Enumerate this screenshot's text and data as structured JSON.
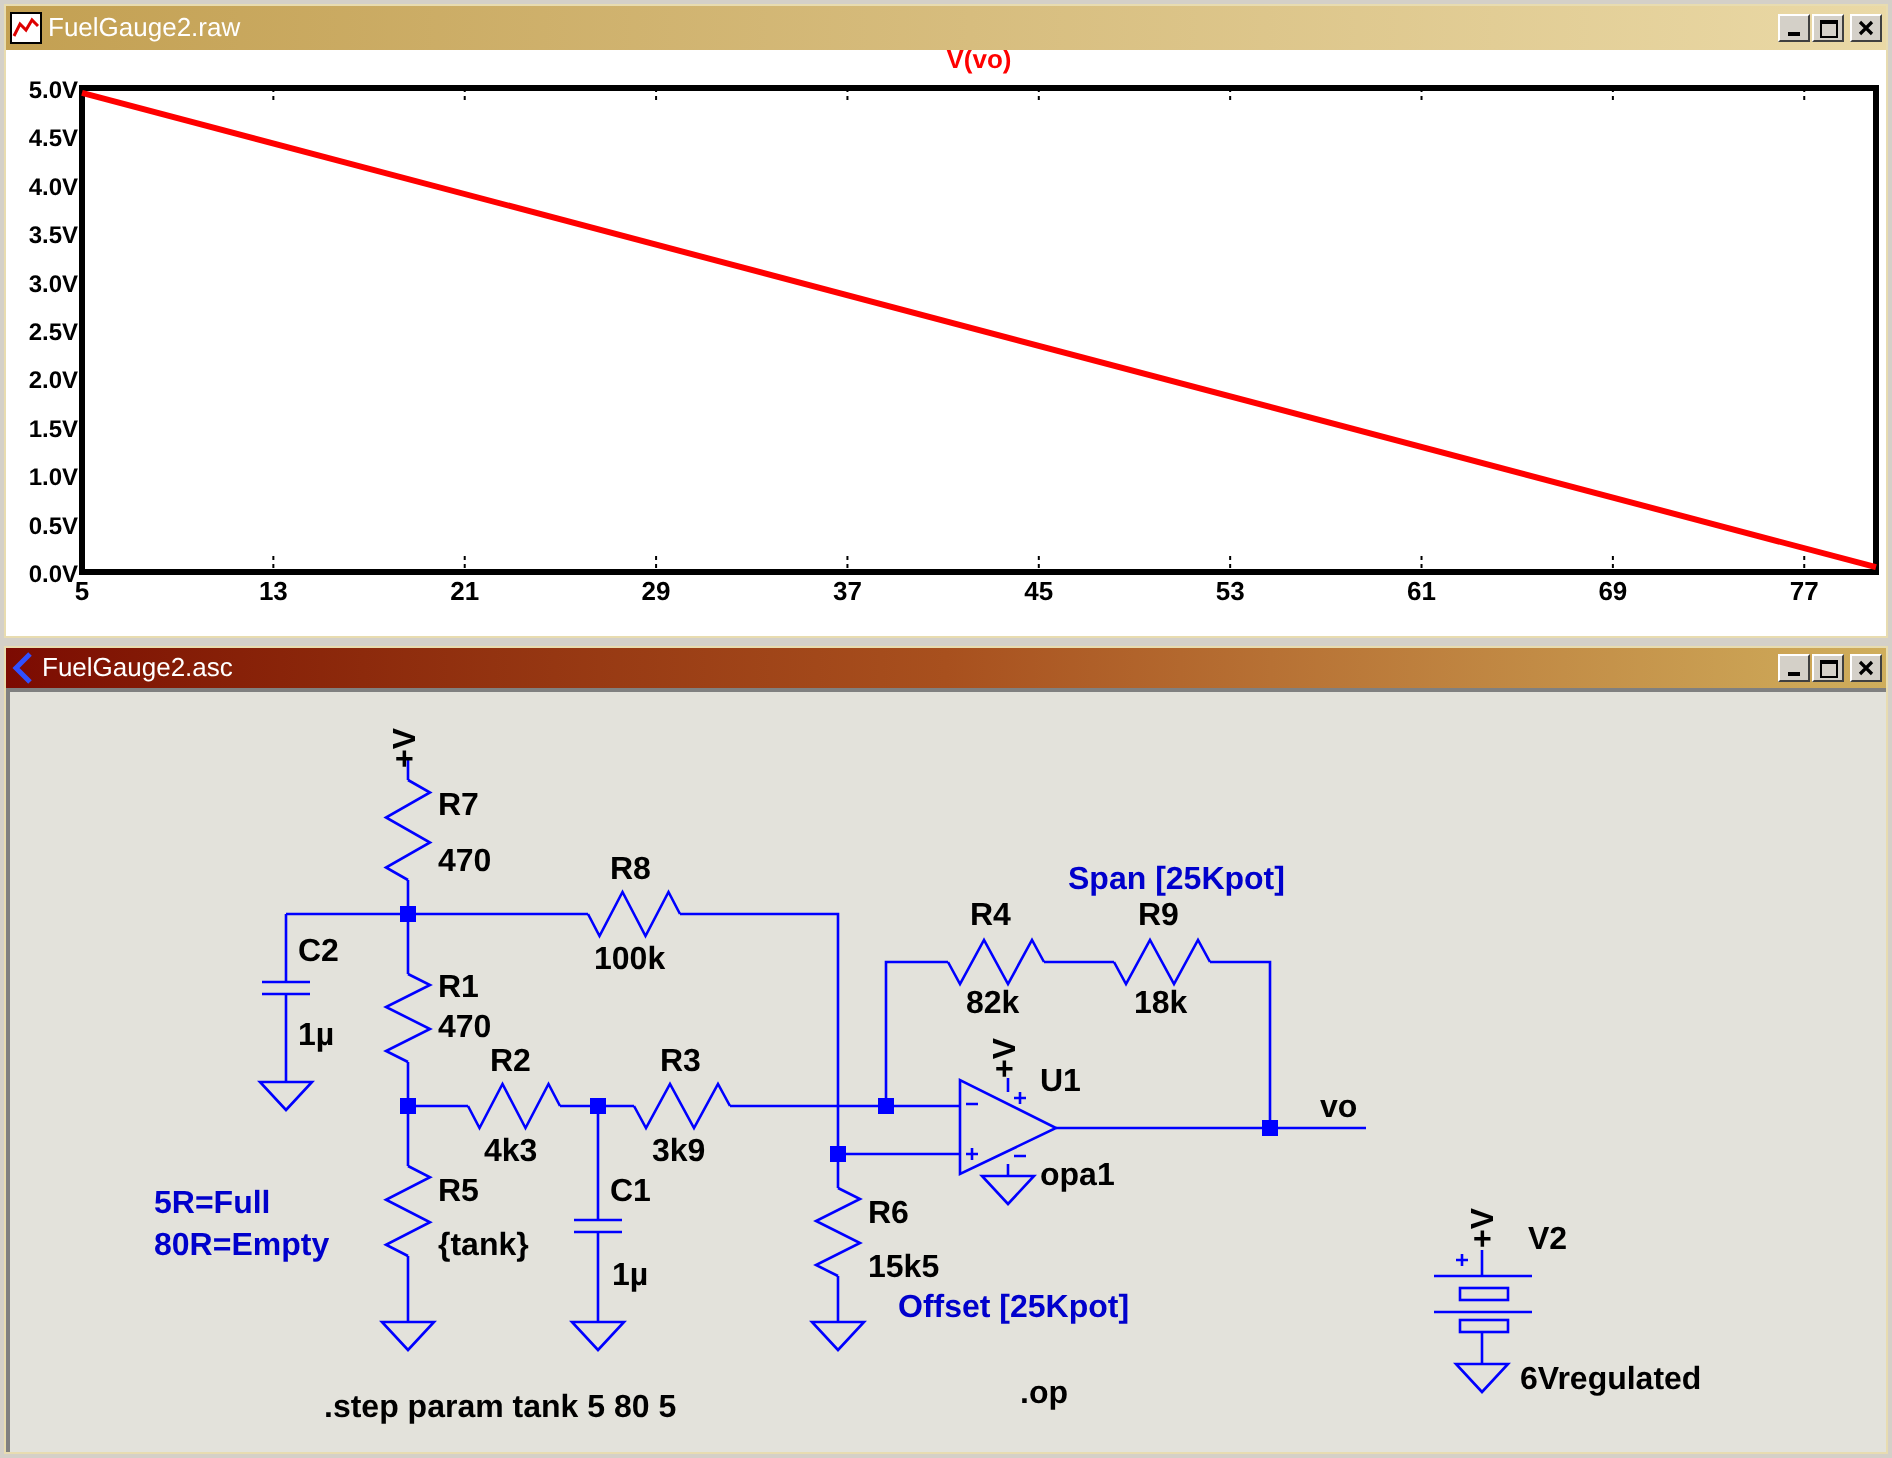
{
  "plot_window": {
    "title": "FuelGauge2.raw",
    "chart_data": {
      "type": "line",
      "x": [
        5,
        80
      ],
      "series": [
        {
          "name": "V(vo)",
          "color": "#ff0000",
          "values": [
            4.95,
            0.05
          ]
        }
      ],
      "xlim": [
        5,
        80
      ],
      "ylim": [
        0,
        5
      ],
      "xticks": [
        5,
        13,
        21,
        29,
        37,
        45,
        53,
        61,
        69,
        77
      ],
      "yticks": [
        {
          "value": 0,
          "label": "0.0V"
        },
        {
          "value": 0.5,
          "label": "0.5V"
        },
        {
          "value": 1,
          "label": "1.0V"
        },
        {
          "value": 1.5,
          "label": "1.5V"
        },
        {
          "value": 2,
          "label": "2.0V"
        },
        {
          "value": 2.5,
          "label": "2.5V"
        },
        {
          "value": 3,
          "label": "3.0V"
        },
        {
          "value": 3.5,
          "label": "3.5V"
        },
        {
          "value": 4,
          "label": "4.0V"
        },
        {
          "value": 4.5,
          "label": "4.5V"
        },
        {
          "value": 5,
          "label": "5.0V"
        }
      ]
    }
  },
  "schematic_window": {
    "title": "FuelGauge2.asc",
    "components": [
      {
        "kind": "resistor",
        "ref": "R7",
        "value": "470"
      },
      {
        "kind": "resistor",
        "ref": "R8",
        "value": "100k"
      },
      {
        "kind": "capacitor",
        "ref": "C2",
        "value": "1µ"
      },
      {
        "kind": "resistor",
        "ref": "R1",
        "value": "470"
      },
      {
        "kind": "resistor",
        "ref": "R2",
        "value": "4k3"
      },
      {
        "kind": "resistor",
        "ref": "R3",
        "value": "3k9"
      },
      {
        "kind": "resistor",
        "ref": "R4",
        "value": "82k"
      },
      {
        "kind": "resistor",
        "ref": "R9",
        "value": "18k"
      },
      {
        "kind": "opamp",
        "ref": "U1",
        "value": "opa1"
      },
      {
        "kind": "resistor",
        "ref": "R5",
        "value": "{tank}"
      },
      {
        "kind": "capacitor",
        "ref": "C1",
        "value": "1µ"
      },
      {
        "kind": "resistor",
        "ref": "R6",
        "value": "15k5"
      },
      {
        "kind": "battery",
        "ref": "V2",
        "value": "6Vregulated"
      }
    ],
    "net_labels": [
      {
        "kind": "supply",
        "text": "+V"
      },
      {
        "kind": "supply",
        "text": "+V"
      },
      {
        "kind": "output",
        "text": "vo"
      },
      {
        "kind": "supply",
        "text": "+V"
      }
    ],
    "comments": [
      "Span [25Kpot]",
      "5R=Full",
      "80R=Empty",
      "Offset [25Kpot]"
    ],
    "directives": [
      ".step param tank 5 80 5",
      ".op"
    ]
  }
}
